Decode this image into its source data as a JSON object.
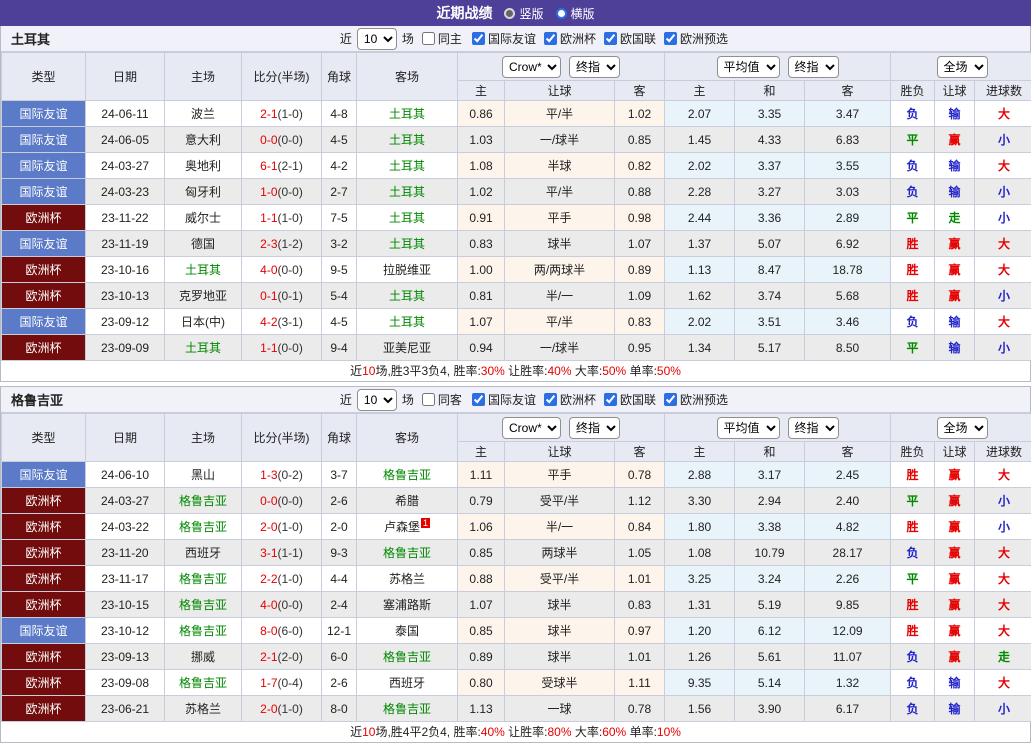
{
  "colors": {
    "topbar_bg": "#4e3f99",
    "type_blue": "#5b7ac7",
    "type_maroon": "#730c0c",
    "red": "#e60000",
    "green": "#008800",
    "blue": "#2323cb",
    "header_bg": "#e7e9f3",
    "row_alt": "#ebebeb",
    "crow_tint": "#fdf4ec",
    "avg_tint": "#e9f3fa"
  },
  "topbar": {
    "title": "近期战绩",
    "radio_vertical": "竖版",
    "radio_horizontal": "横版",
    "vertical_selected": true
  },
  "filters": {
    "near": "近",
    "count": "10",
    "games": "场",
    "leagues": [
      "国际友谊",
      "欧洲杯",
      "欧国联",
      "欧洲预选"
    ]
  },
  "header": {
    "cols": [
      "类型",
      "日期",
      "主场",
      "比分(半场)",
      "角球",
      "客场"
    ],
    "crow_select": "Crow*",
    "final_select": "终指",
    "avg_select": "平均值",
    "full_select": "全场",
    "crow_cols": [
      "主",
      "让球",
      "客"
    ],
    "avg_cols": [
      "主",
      "和",
      "客"
    ],
    "full_cols": [
      "胜负",
      "让球",
      "进球数"
    ]
  },
  "sections": [
    {
      "team": "土耳其",
      "same_label": "同主",
      "rows": [
        {
          "league": "国际友谊",
          "lc": "blue",
          "date": "24-06-11",
          "home": "波兰",
          "hg": false,
          "score": "2-1",
          "half": "(1-0)",
          "corner": "4-8",
          "away": "土耳其",
          "ag": true,
          "badge": "",
          "odds": [
            "0.86",
            "平/半",
            "1.02",
            "2.07",
            "3.35",
            "3.47"
          ],
          "res": [
            "负",
            "blue"
          ],
          "let": [
            "输",
            "blue"
          ],
          "size": [
            "大",
            "red"
          ]
        },
        {
          "league": "国际友谊",
          "lc": "blue",
          "date": "24-06-05",
          "home": "意大利",
          "hg": false,
          "score": "0-0",
          "half": "(0-0)",
          "corner": "4-5",
          "away": "土耳其",
          "ag": true,
          "badge": "",
          "odds": [
            "1.03",
            "一/球半",
            "0.85",
            "1.45",
            "4.33",
            "6.83"
          ],
          "res": [
            "平",
            "green"
          ],
          "let": [
            "赢",
            "red"
          ],
          "size": [
            "小",
            "blue"
          ]
        },
        {
          "league": "国际友谊",
          "lc": "blue",
          "date": "24-03-27",
          "home": "奥地利",
          "hg": false,
          "score": "6-1",
          "half": "(2-1)",
          "corner": "4-2",
          "away": "土耳其",
          "ag": true,
          "badge": "",
          "odds": [
            "1.08",
            "半球",
            "0.82",
            "2.02",
            "3.37",
            "3.55"
          ],
          "res": [
            "负",
            "blue"
          ],
          "let": [
            "输",
            "blue"
          ],
          "size": [
            "大",
            "red"
          ]
        },
        {
          "league": "国际友谊",
          "lc": "blue",
          "date": "24-03-23",
          "home": "匈牙利",
          "hg": false,
          "score": "1-0",
          "half": "(0-0)",
          "corner": "2-7",
          "away": "土耳其",
          "ag": true,
          "badge": "",
          "odds": [
            "1.02",
            "平/半",
            "0.88",
            "2.28",
            "3.27",
            "3.03"
          ],
          "res": [
            "负",
            "blue"
          ],
          "let": [
            "输",
            "blue"
          ],
          "size": [
            "小",
            "blue"
          ]
        },
        {
          "league": "欧洲杯",
          "lc": "maroon",
          "date": "23-11-22",
          "home": "威尔士",
          "hg": false,
          "score": "1-1",
          "half": "(1-0)",
          "corner": "7-5",
          "away": "土耳其",
          "ag": true,
          "badge": "",
          "odds": [
            "0.91",
            "平手",
            "0.98",
            "2.44",
            "3.36",
            "2.89"
          ],
          "res": [
            "平",
            "green"
          ],
          "let": [
            "走",
            "green"
          ],
          "size": [
            "小",
            "blue"
          ]
        },
        {
          "league": "国际友谊",
          "lc": "blue",
          "date": "23-11-19",
          "home": "德国",
          "hg": false,
          "score": "2-3",
          "half": "(1-2)",
          "corner": "3-2",
          "away": "土耳其",
          "ag": true,
          "badge": "",
          "odds": [
            "0.83",
            "球半",
            "1.07",
            "1.37",
            "5.07",
            "6.92"
          ],
          "res": [
            "胜",
            "red"
          ],
          "let": [
            "赢",
            "red"
          ],
          "size": [
            "大",
            "red"
          ]
        },
        {
          "league": "欧洲杯",
          "lc": "maroon",
          "date": "23-10-16",
          "home": "土耳其",
          "hg": true,
          "score": "4-0",
          "half": "(0-0)",
          "corner": "9-5",
          "away": "拉脱维亚",
          "ag": false,
          "badge": "",
          "odds": [
            "1.00",
            "两/两球半",
            "0.89",
            "1.13",
            "8.47",
            "18.78"
          ],
          "res": [
            "胜",
            "red"
          ],
          "let": [
            "赢",
            "red"
          ],
          "size": [
            "大",
            "red"
          ]
        },
        {
          "league": "欧洲杯",
          "lc": "maroon",
          "date": "23-10-13",
          "home": "克罗地亚",
          "hg": false,
          "score": "0-1",
          "half": "(0-1)",
          "corner": "5-4",
          "away": "土耳其",
          "ag": true,
          "badge": "",
          "odds": [
            "0.81",
            "半/一",
            "1.09",
            "1.62",
            "3.74",
            "5.68"
          ],
          "res": [
            "胜",
            "red"
          ],
          "let": [
            "赢",
            "red"
          ],
          "size": [
            "小",
            "blue"
          ]
        },
        {
          "league": "国际友谊",
          "lc": "blue",
          "date": "23-09-12",
          "home": "日本(中)",
          "hg": false,
          "score": "4-2",
          "half": "(3-1)",
          "corner": "4-5",
          "away": "土耳其",
          "ag": true,
          "badge": "",
          "odds": [
            "1.07",
            "平/半",
            "0.83",
            "2.02",
            "3.51",
            "3.46"
          ],
          "res": [
            "负",
            "blue"
          ],
          "let": [
            "输",
            "blue"
          ],
          "size": [
            "大",
            "red"
          ]
        },
        {
          "league": "欧洲杯",
          "lc": "maroon",
          "date": "23-09-09",
          "home": "土耳其",
          "hg": true,
          "score": "1-1",
          "half": "(0-0)",
          "corner": "9-4",
          "away": "亚美尼亚",
          "ag": false,
          "badge": "",
          "odds": [
            "0.94",
            "一/球半",
            "0.95",
            "1.34",
            "5.17",
            "8.50"
          ],
          "res": [
            "平",
            "green"
          ],
          "let": [
            "输",
            "blue"
          ],
          "size": [
            "小",
            "blue"
          ]
        }
      ],
      "summary": [
        {
          "t": "近",
          "c": "dark"
        },
        {
          "t": "10",
          "c": "red"
        },
        {
          "t": "场,胜3平3负4, 胜率:",
          "c": "dark"
        },
        {
          "t": "30%",
          "c": "red"
        },
        {
          "t": " 让胜率:",
          "c": "dark"
        },
        {
          "t": "40%",
          "c": "red"
        },
        {
          "t": " 大率:",
          "c": "dark"
        },
        {
          "t": "50%",
          "c": "red"
        },
        {
          "t": " 单率:",
          "c": "dark"
        },
        {
          "t": "50%",
          "c": "red"
        }
      ]
    },
    {
      "team": "格鲁吉亚",
      "same_label": "同客",
      "rows": [
        {
          "league": "国际友谊",
          "lc": "blue",
          "date": "24-06-10",
          "home": "黑山",
          "hg": false,
          "score": "1-3",
          "half": "(0-2)",
          "corner": "3-7",
          "away": "格鲁吉亚",
          "ag": true,
          "badge": "",
          "odds": [
            "1.11",
            "平手",
            "0.78",
            "2.88",
            "3.17",
            "2.45"
          ],
          "res": [
            "胜",
            "red"
          ],
          "let": [
            "赢",
            "red"
          ],
          "size": [
            "大",
            "red"
          ]
        },
        {
          "league": "欧洲杯",
          "lc": "maroon",
          "date": "24-03-27",
          "home": "格鲁吉亚",
          "hg": true,
          "score": "0-0",
          "half": "(0-0)",
          "corner": "2-6",
          "away": "希腊",
          "ag": false,
          "badge": "",
          "odds": [
            "0.79",
            "受平/半",
            "1.12",
            "3.30",
            "2.94",
            "2.40"
          ],
          "res": [
            "平",
            "green"
          ],
          "let": [
            "赢",
            "red"
          ],
          "size": [
            "小",
            "blue"
          ]
        },
        {
          "league": "欧洲杯",
          "lc": "maroon",
          "date": "24-03-22",
          "home": "格鲁吉亚",
          "hg": true,
          "score": "2-0",
          "half": "(1-0)",
          "corner": "2-0",
          "away": "卢森堡",
          "ag": false,
          "badge": "1",
          "odds": [
            "1.06",
            "半/一",
            "0.84",
            "1.80",
            "3.38",
            "4.82"
          ],
          "res": [
            "胜",
            "red"
          ],
          "let": [
            "赢",
            "red"
          ],
          "size": [
            "小",
            "blue"
          ]
        },
        {
          "league": "欧洲杯",
          "lc": "maroon",
          "date": "23-11-20",
          "home": "西班牙",
          "hg": false,
          "score": "3-1",
          "half": "(1-1)",
          "corner": "9-3",
          "away": "格鲁吉亚",
          "ag": true,
          "badge": "",
          "odds": [
            "0.85",
            "两球半",
            "1.05",
            "1.08",
            "10.79",
            "28.17"
          ],
          "res": [
            "负",
            "blue"
          ],
          "let": [
            "赢",
            "red"
          ],
          "size": [
            "大",
            "red"
          ]
        },
        {
          "league": "欧洲杯",
          "lc": "maroon",
          "date": "23-11-17",
          "home": "格鲁吉亚",
          "hg": true,
          "score": "2-2",
          "half": "(1-0)",
          "corner": "4-4",
          "away": "苏格兰",
          "ag": false,
          "badge": "",
          "odds": [
            "0.88",
            "受平/半",
            "1.01",
            "3.25",
            "3.24",
            "2.26"
          ],
          "res": [
            "平",
            "green"
          ],
          "let": [
            "赢",
            "red"
          ],
          "size": [
            "大",
            "red"
          ]
        },
        {
          "league": "欧洲杯",
          "lc": "maroon",
          "date": "23-10-15",
          "home": "格鲁吉亚",
          "hg": true,
          "score": "4-0",
          "half": "(0-0)",
          "corner": "2-4",
          "away": "塞浦路斯",
          "ag": false,
          "badge": "",
          "odds": [
            "1.07",
            "球半",
            "0.83",
            "1.31",
            "5.19",
            "9.85"
          ],
          "res": [
            "胜",
            "red"
          ],
          "let": [
            "赢",
            "red"
          ],
          "size": [
            "大",
            "red"
          ]
        },
        {
          "league": "国际友谊",
          "lc": "blue",
          "date": "23-10-12",
          "home": "格鲁吉亚",
          "hg": true,
          "score": "8-0",
          "half": "(6-0)",
          "corner": "12-1",
          "away": "泰国",
          "ag": false,
          "badge": "",
          "odds": [
            "0.85",
            "球半",
            "0.97",
            "1.20",
            "6.12",
            "12.09"
          ],
          "res": [
            "胜",
            "red"
          ],
          "let": [
            "赢",
            "red"
          ],
          "size": [
            "大",
            "red"
          ]
        },
        {
          "league": "欧洲杯",
          "lc": "maroon",
          "date": "23-09-13",
          "home": "挪威",
          "hg": false,
          "score": "2-1",
          "half": "(2-0)",
          "corner": "6-0",
          "away": "格鲁吉亚",
          "ag": true,
          "badge": "",
          "odds": [
            "0.89",
            "球半",
            "1.01",
            "1.26",
            "5.61",
            "11.07"
          ],
          "res": [
            "负",
            "blue"
          ],
          "let": [
            "赢",
            "red"
          ],
          "size": [
            "走",
            "green"
          ]
        },
        {
          "league": "欧洲杯",
          "lc": "maroon",
          "date": "23-09-08",
          "home": "格鲁吉亚",
          "hg": true,
          "score": "1-7",
          "half": "(0-4)",
          "corner": "2-6",
          "away": "西班牙",
          "ag": false,
          "badge": "",
          "odds": [
            "0.80",
            "受球半",
            "1.11",
            "9.35",
            "5.14",
            "1.32"
          ],
          "res": [
            "负",
            "blue"
          ],
          "let": [
            "输",
            "blue"
          ],
          "size": [
            "大",
            "red"
          ]
        },
        {
          "league": "欧洲杯",
          "lc": "maroon",
          "date": "23-06-21",
          "home": "苏格兰",
          "hg": false,
          "score": "2-0",
          "half": "(1-0)",
          "corner": "8-0",
          "away": "格鲁吉亚",
          "ag": true,
          "badge": "",
          "odds": [
            "1.13",
            "一球",
            "0.78",
            "1.56",
            "3.90",
            "6.17"
          ],
          "res": [
            "负",
            "blue"
          ],
          "let": [
            "输",
            "blue"
          ],
          "size": [
            "小",
            "blue"
          ]
        }
      ],
      "summary": [
        {
          "t": "近",
          "c": "dark"
        },
        {
          "t": "10",
          "c": "red"
        },
        {
          "t": "场,胜4平2负4, 胜率:",
          "c": "dark"
        },
        {
          "t": "40%",
          "c": "red"
        },
        {
          "t": " 让胜率:",
          "c": "dark"
        },
        {
          "t": "80%",
          "c": "red"
        },
        {
          "t": " 大率:",
          "c": "dark"
        },
        {
          "t": "60%",
          "c": "red"
        },
        {
          "t": " 单率:",
          "c": "dark"
        },
        {
          "t": "10%",
          "c": "red"
        }
      ]
    }
  ]
}
